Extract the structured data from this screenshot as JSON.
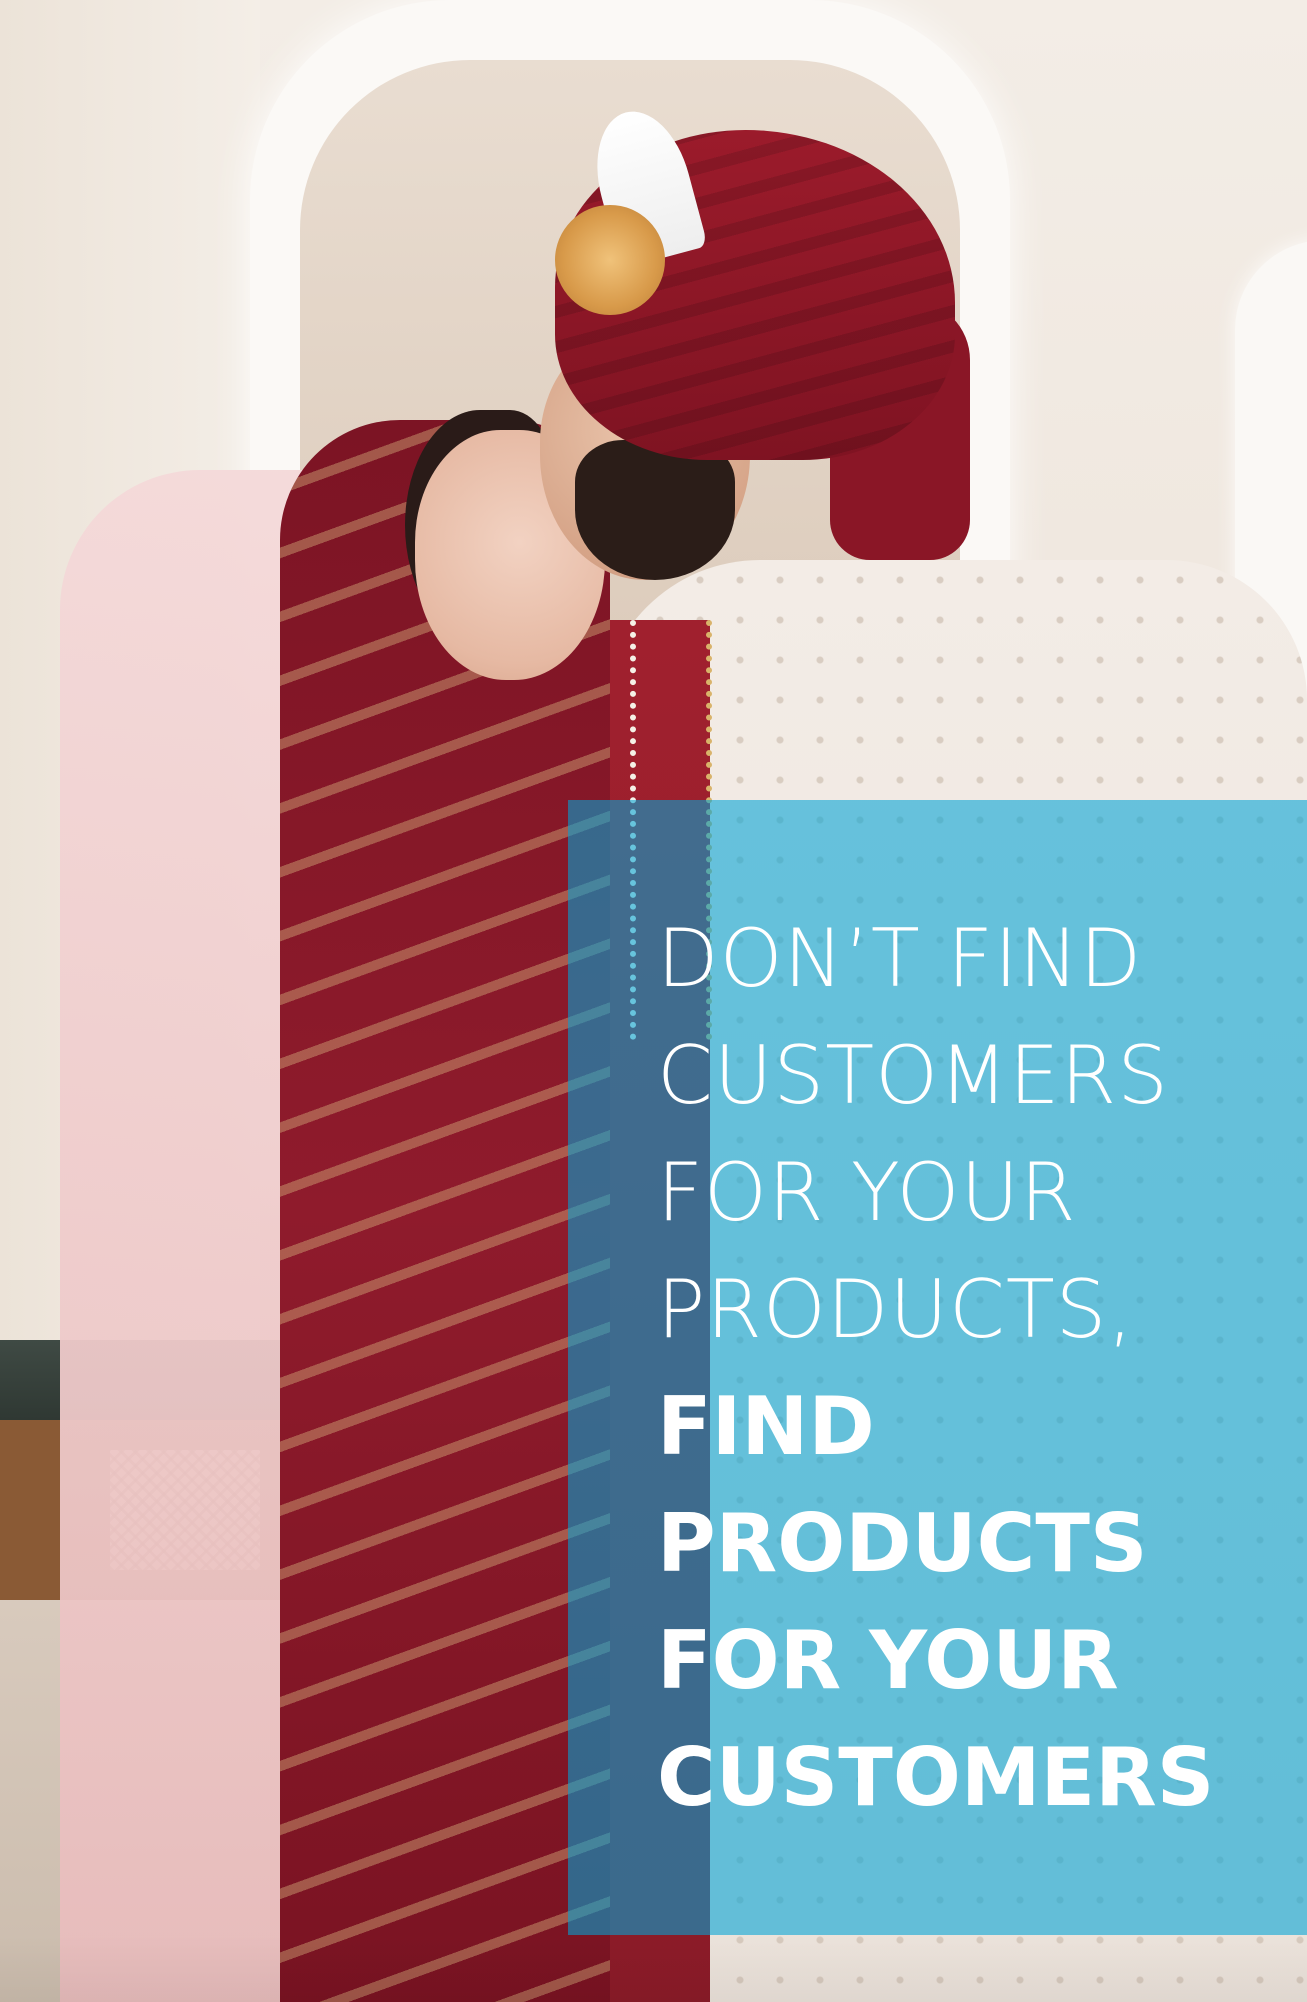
{
  "headline": {
    "light_lines": [
      "DON’T FIND",
      "CUSTOMERS",
      "FOR YOUR",
      "PRODUCTS,"
    ],
    "bold_lines": [
      "FIND",
      "PRODUCTS",
      "FOR YOUR",
      "CUSTOMERS"
    ]
  },
  "colors": {
    "overlay": "#00a4d6",
    "text": "#ffffff"
  }
}
